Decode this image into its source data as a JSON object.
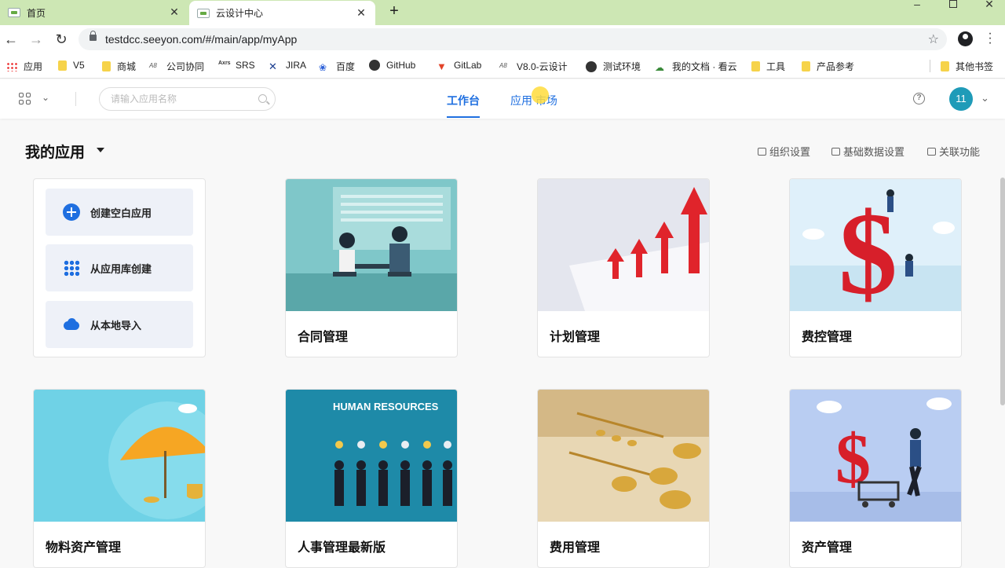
{
  "browser": {
    "tabs": [
      {
        "title": "首页"
      },
      {
        "title": "云设计中心"
      }
    ],
    "url": "testdcc.seeyon.com/#/main/app/myApp",
    "bookmarks": [
      {
        "label": "应用",
        "icon": "apps-grid-icon"
      },
      {
        "label": "V5",
        "icon": "folder-icon"
      },
      {
        "label": "商城",
        "icon": "folder-icon"
      },
      {
        "label": "公司协同",
        "icon": "a8-icon"
      },
      {
        "label": "SRS",
        "icon": "axure-icon"
      },
      {
        "label": "JIRA",
        "icon": "jira-icon"
      },
      {
        "label": "百度",
        "icon": "baidu-paw-icon"
      },
      {
        "label": "GitHub",
        "icon": "github-icon"
      },
      {
        "label": "GitLab",
        "icon": "gitlab-icon"
      },
      {
        "label": "V8.0-云设计",
        "icon": "a8-icon"
      },
      {
        "label": "测试环境",
        "icon": "globe-icon"
      },
      {
        "label": "我的文档 · 看云",
        "icon": "kancloud-icon"
      },
      {
        "label": "工具",
        "icon": "folder-icon"
      },
      {
        "label": "产品参考",
        "icon": "folder-icon"
      },
      {
        "label": "其他书签",
        "icon": "folder-icon"
      }
    ]
  },
  "header": {
    "search_placeholder": "请输入应用名称",
    "tabs": [
      {
        "label": "工作台",
        "active": true
      },
      {
        "label": "应用 市场",
        "active": false
      }
    ],
    "avatar_text": "11"
  },
  "main": {
    "title": "我的应用",
    "links": [
      {
        "label": "组织设置",
        "icon": "org-icon"
      },
      {
        "label": "基础数据设置",
        "icon": "database-icon"
      },
      {
        "label": "关联功能",
        "icon": "link-icon"
      }
    ],
    "create": [
      {
        "label": "创建空白应用",
        "icon": "plus-circle-icon"
      },
      {
        "label": "从应用库创建",
        "icon": "app-grid-icon"
      },
      {
        "label": "从本地导入",
        "icon": "cloud-upload-icon"
      }
    ],
    "apps": [
      {
        "name": "合同管理"
      },
      {
        "name": "计划管理"
      },
      {
        "name": "费控管理"
      },
      {
        "name": "物料资产管理"
      },
      {
        "name": "人事管理最新版",
        "banner": "HUMAN RESOURCES"
      },
      {
        "name": "费用管理"
      },
      {
        "name": "资产管理"
      }
    ]
  },
  "colors": {
    "accent": "#1f6fe0",
    "tabstrip": "#cde7b4",
    "avatar": "#1f9bb8"
  }
}
